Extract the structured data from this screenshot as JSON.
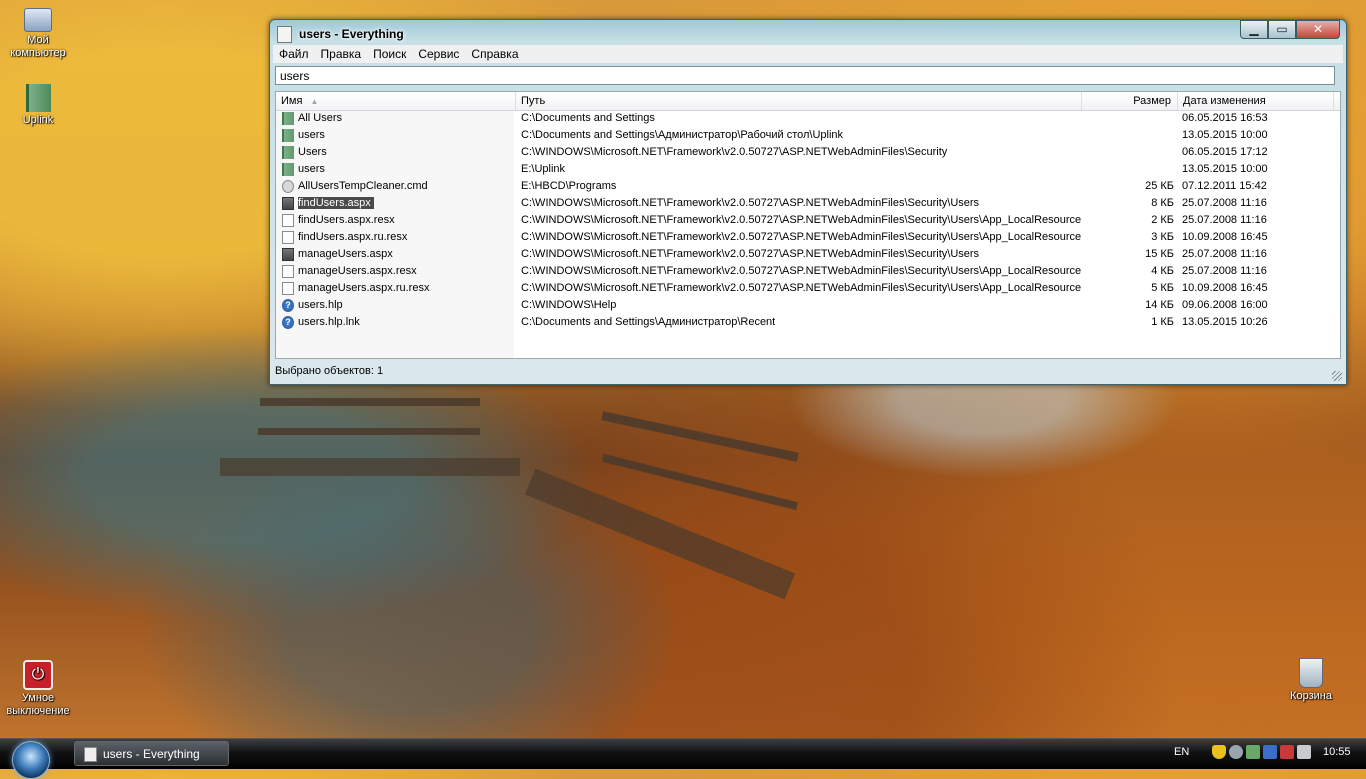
{
  "desktop": {
    "icons": [
      {
        "label": "Мой компьютер"
      },
      {
        "label": "Uplink"
      },
      {
        "label": "Умное выключение"
      },
      {
        "label": "Корзина"
      }
    ]
  },
  "window": {
    "title": "users - Everything",
    "menu": [
      "Файл",
      "Правка",
      "Поиск",
      "Сервис",
      "Справка"
    ],
    "search_value": "users",
    "columns": {
      "name": "Имя",
      "path": "Путь",
      "size": "Размер",
      "date": "Дата изменения"
    },
    "rows": [
      {
        "icon": "folder-icon",
        "name": "All Users",
        "path": "C:\\Documents and Settings",
        "size": "",
        "date": "06.05.2015 16:53"
      },
      {
        "icon": "folder-icon",
        "name": "users",
        "path": "C:\\Documents and Settings\\Администратор\\Рабочий стол\\Uplink",
        "size": "",
        "date": "13.05.2015 10:00"
      },
      {
        "icon": "folder-icon",
        "name": "Users",
        "path": "C:\\WINDOWS\\Microsoft.NET\\Framework\\v2.0.50727\\ASP.NETWebAdminFiles\\Security",
        "size": "",
        "date": "06.05.2015 17:12"
      },
      {
        "icon": "folder-icon",
        "name": "users",
        "path": "E:\\Uplink",
        "size": "",
        "date": "13.05.2015 10:00"
      },
      {
        "icon": "gear-file-icon",
        "name": "AllUsersTempCleaner.cmd",
        "path": "E:\\HBCD\\Programs",
        "size": "25 КБ",
        "date": "07.12.2011 15:42"
      },
      {
        "icon": "aspx-file-icon",
        "name": "findUsers.aspx",
        "path": "C:\\WINDOWS\\Microsoft.NET\\Framework\\v2.0.50727\\ASP.NETWebAdminFiles\\Security\\Users",
        "size": "8 КБ",
        "date": "25.07.2008 11:16",
        "selected": true
      },
      {
        "icon": "document-icon",
        "name": "findUsers.aspx.resx",
        "path": "C:\\WINDOWS\\Microsoft.NET\\Framework\\v2.0.50727\\ASP.NETWebAdminFiles\\Security\\Users\\App_LocalResources",
        "size": "2 КБ",
        "date": "25.07.2008 11:16"
      },
      {
        "icon": "document-icon",
        "name": "findUsers.aspx.ru.resx",
        "path": "C:\\WINDOWS\\Microsoft.NET\\Framework\\v2.0.50727\\ASP.NETWebAdminFiles\\Security\\Users\\App_LocalResources",
        "size": "3 КБ",
        "date": "10.09.2008 16:45"
      },
      {
        "icon": "aspx-file-icon",
        "name": "manageUsers.aspx",
        "path": "C:\\WINDOWS\\Microsoft.NET\\Framework\\v2.0.50727\\ASP.NETWebAdminFiles\\Security\\Users",
        "size": "15 КБ",
        "date": "25.07.2008 11:16"
      },
      {
        "icon": "document-icon",
        "name": "manageUsers.aspx.resx",
        "path": "C:\\WINDOWS\\Microsoft.NET\\Framework\\v2.0.50727\\ASP.NETWebAdminFiles\\Security\\Users\\App_LocalResources",
        "size": "4 КБ",
        "date": "25.07.2008 11:16"
      },
      {
        "icon": "document-icon",
        "name": "manageUsers.aspx.ru.resx",
        "path": "C:\\WINDOWS\\Microsoft.NET\\Framework\\v2.0.50727\\ASP.NETWebAdminFiles\\Security\\Users\\App_LocalResources",
        "size": "5 КБ",
        "date": "10.09.2008 16:45"
      },
      {
        "icon": "help-file-icon",
        "name": "users.hlp",
        "path": "C:\\WINDOWS\\Help",
        "size": "14 КБ",
        "date": "09.06.2008 16:00"
      },
      {
        "icon": "help-file-icon",
        "name": "users.hlp.lnk",
        "path": "C:\\Documents and Settings\\Администратор\\Recent",
        "size": "1 КБ",
        "date": "13.05.2015 10:26"
      }
    ],
    "status": "Выбрано объектов: 1"
  },
  "taskbar": {
    "task_label": "users - Everything",
    "language": "EN",
    "clock": "10:55"
  }
}
